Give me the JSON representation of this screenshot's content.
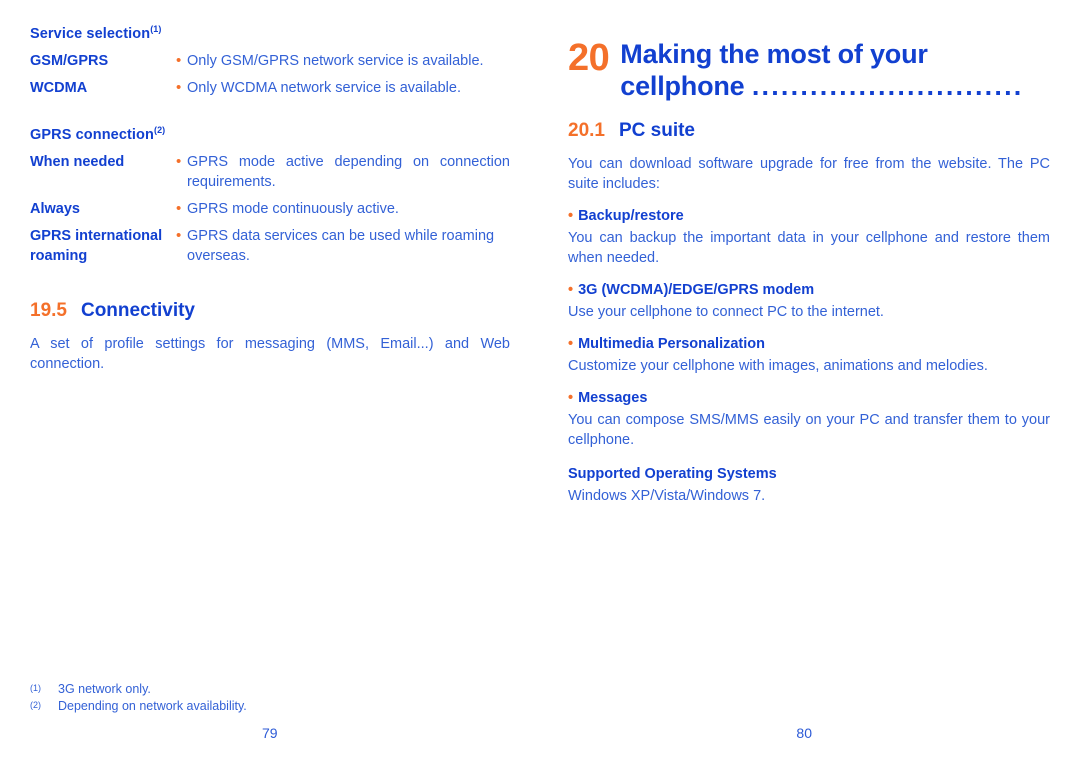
{
  "colors": {
    "heading_blue": "#1240d0",
    "body_blue": "#3361d6",
    "accent_orange": "#f4702a"
  },
  "left_page": {
    "page_number": "79",
    "service_selection": {
      "title": "Service selection",
      "footnote_mark": "(1)",
      "rows": [
        {
          "term": "GSM/GPRS",
          "bullet": "•",
          "desc": "Only GSM/GPRS network service is available."
        },
        {
          "term": "WCDMA",
          "bullet": "•",
          "desc": "Only WCDMA network service is available."
        }
      ]
    },
    "gprs_connection": {
      "title": "GPRS connection",
      "footnote_mark": "(2)",
      "rows": [
        {
          "term": "When needed",
          "bullet": "•",
          "desc": "GPRS mode active depending on connection requirements."
        },
        {
          "term": "Always",
          "bullet": "•",
          "desc": "GPRS mode continuously active."
        },
        {
          "term": "GPRS international roaming",
          "bullet": "•",
          "desc": "GPRS data services can be used while roaming overseas."
        }
      ]
    },
    "connectivity": {
      "number": "19.5",
      "title": "Connectivity",
      "paragraph": "A set of profile settings for messaging (MMS, Email...) and Web connection."
    },
    "footnotes": [
      {
        "mark": "(1)",
        "text": "3G network only."
      },
      {
        "mark": "(2)",
        "text": "Depending on network availability."
      }
    ]
  },
  "right_page": {
    "page_number": "80",
    "chapter": {
      "number": "20",
      "title_line1": "Making the most of your",
      "title_line2": "cellphone",
      "leader": "............................"
    },
    "pc_suite": {
      "number": "20.1",
      "title": "PC suite",
      "intro": "You can download software upgrade for free from the website. The PC suite includes:",
      "items": [
        {
          "bullet": "•",
          "heading": "Backup/restore",
          "body": "You can backup the important data in your cellphone and restore them when needed."
        },
        {
          "bullet": "•",
          "heading": "3G (WCDMA)/EDGE/GPRS modem",
          "body": "Use your cellphone to connect PC to the internet."
        },
        {
          "bullet": "•",
          "heading": "Multimedia Personalization",
          "body": "Customize your cellphone with images, animations and melodies."
        },
        {
          "bullet": "•",
          "heading": "Messages",
          "body": "You can compose SMS/MMS easily on your PC and transfer them to your cellphone."
        }
      ],
      "supported_os": {
        "heading": "Supported Operating Systems",
        "body": "Windows XP/Vista/Windows 7."
      }
    }
  }
}
